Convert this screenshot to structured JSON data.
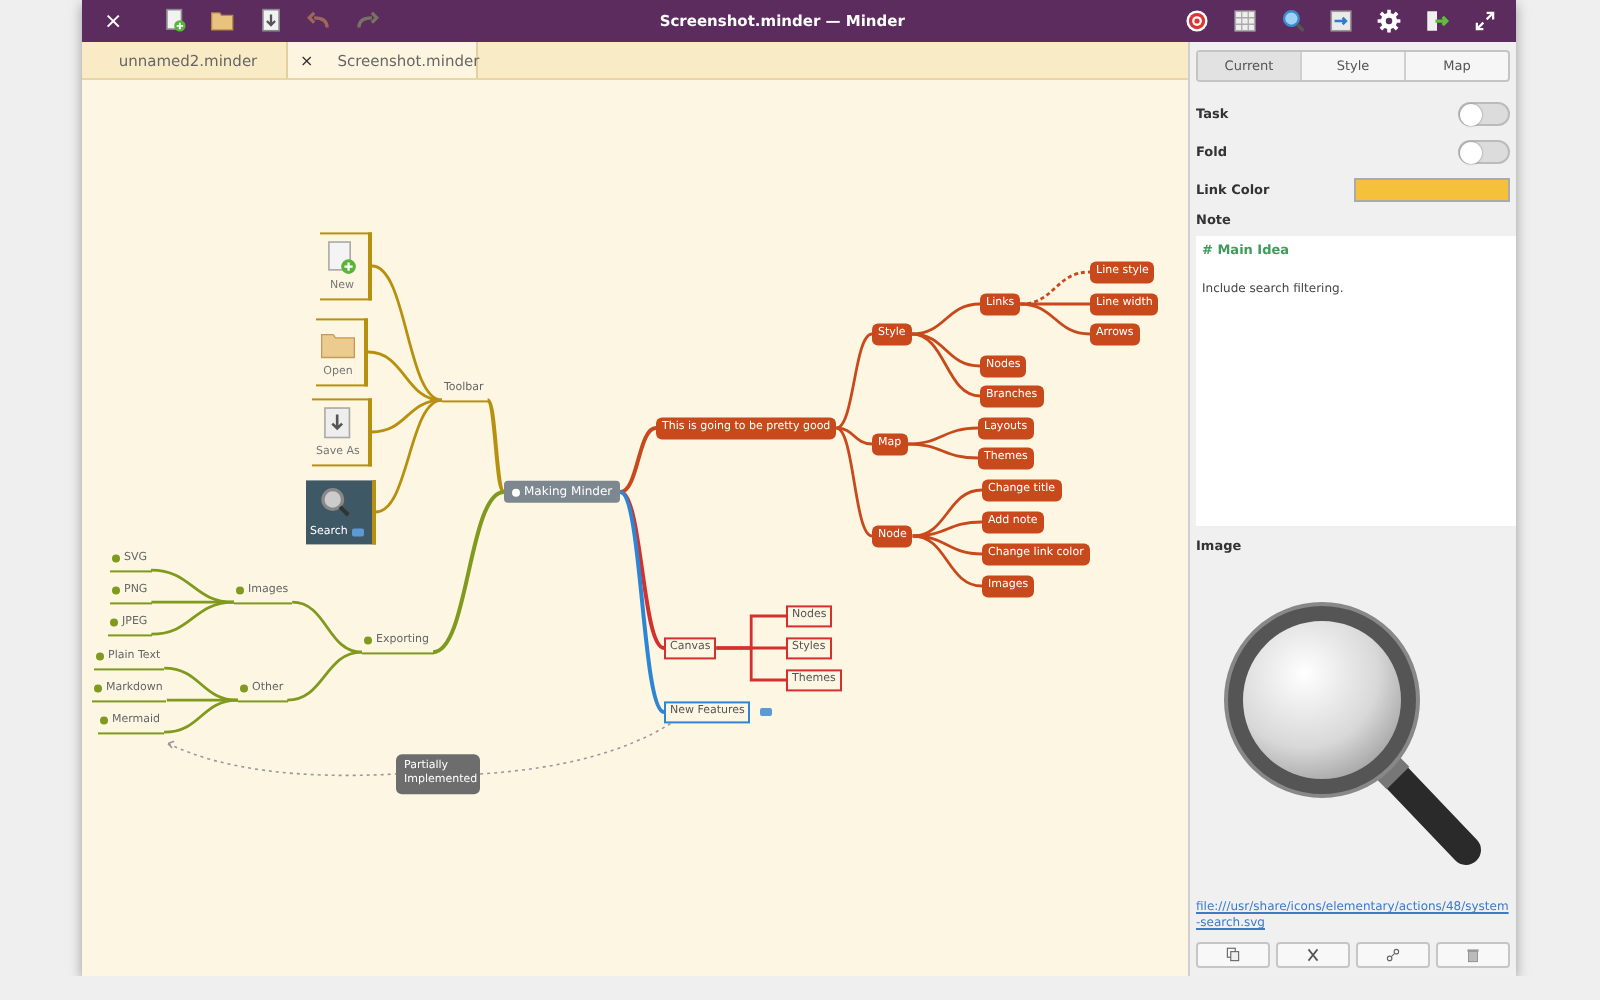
{
  "window": {
    "close": "×",
    "title": "Screenshot.minder — Minder",
    "left_tools": [
      {
        "kind": "new-file",
        "disabled": false
      },
      {
        "kind": "open",
        "disabled": false
      },
      {
        "kind": "save",
        "disabled": false
      },
      {
        "kind": "undo",
        "disabled": true
      },
      {
        "kind": "redo",
        "disabled": true
      }
    ],
    "right_tools": [
      {
        "kind": "target"
      },
      {
        "kind": "grid"
      },
      {
        "kind": "search"
      },
      {
        "kind": "export"
      },
      {
        "kind": "settings"
      },
      {
        "kind": "exit"
      },
      {
        "kind": "fullscreen"
      }
    ]
  },
  "tabs": [
    {
      "label": "unnamed2.minder",
      "selected": false
    },
    {
      "label": "Screenshot.minder",
      "selected": true,
      "close": "×"
    }
  ],
  "mind_map": {
    "root": {
      "text": "Making Minder",
      "kind": "root",
      "children": [
        {
          "text": "Toolbar",
          "kind": "text",
          "color": "#b8900f",
          "children": [
            {
              "text": "New",
              "kind": "image",
              "selected": false
            },
            {
              "text": "Open",
              "kind": "image",
              "selected": false
            },
            {
              "text": "Save As",
              "kind": "image",
              "selected": false
            },
            {
              "text": "Search",
              "kind": "image",
              "selected": true,
              "has_note": true
            }
          ]
        },
        {
          "text": "Exporting",
          "kind": "dot-text",
          "color": "#7f9a1c",
          "children": [
            {
              "text": "Images",
              "kind": "dot-text",
              "children": [
                {
                  "text": "SVG",
                  "kind": "dot-text"
                },
                {
                  "text": "PNG",
                  "kind": "dot-text"
                },
                {
                  "text": "JPEG",
                  "kind": "dot-text"
                }
              ]
            },
            {
              "text": "Other",
              "kind": "dot-text",
              "children": [
                {
                  "text": "Plain Text",
                  "kind": "dot-text"
                },
                {
                  "text": "Markdown",
                  "kind": "dot-text"
                },
                {
                  "text": "Mermaid",
                  "kind": "dot-text",
                  "connection": {
                    "label": "Partially Implemented"
                  }
                }
              ]
            }
          ]
        },
        {
          "text": "This is going to be pretty good",
          "kind": "filled",
          "color": "#c8491c",
          "children": [
            {
              "text": "Style",
              "kind": "filled",
              "children": [
                {
                  "text": "Links",
                  "kind": "filled",
                  "children": [
                    {
                      "text": "Line style",
                      "kind": "filled",
                      "dashed": true
                    },
                    {
                      "text": "Line width",
                      "kind": "filled"
                    },
                    {
                      "text": "Arrows",
                      "kind": "filled"
                    }
                  ]
                },
                {
                  "text": "Nodes",
                  "kind": "filled"
                },
                {
                  "text": "Branches",
                  "kind": "filled"
                }
              ]
            },
            {
              "text": "Map",
              "kind": "filled",
              "children": [
                {
                  "text": "Layouts",
                  "kind": "filled"
                },
                {
                  "text": "Themes",
                  "kind": "filled"
                }
              ]
            },
            {
              "text": "Node",
              "kind": "filled",
              "children": [
                {
                  "text": "Change title",
                  "kind": "filled"
                },
                {
                  "text": "Add note",
                  "kind": "filled"
                },
                {
                  "text": "Change link color",
                  "kind": "filled"
                },
                {
                  "text": "Images",
                  "kind": "filled"
                }
              ]
            }
          ]
        },
        {
          "text": "Canvas",
          "kind": "outlined",
          "color": "#d3302e",
          "children": [
            {
              "text": "Nodes",
              "kind": "outlined"
            },
            {
              "text": "Styles",
              "kind": "outlined"
            },
            {
              "text": "Themes",
              "kind": "outlined"
            }
          ]
        },
        {
          "text": "New Features",
          "kind": "outlined",
          "color": "#2c86d4",
          "has_note": true
        }
      ]
    }
  },
  "sidebar": {
    "tabs": [
      {
        "label": "Current",
        "selected": true
      },
      {
        "label": "Style",
        "selected": false
      },
      {
        "label": "Map",
        "selected": false
      }
    ],
    "switches": [
      {
        "label": "Task",
        "on": false
      },
      {
        "label": "Fold",
        "on": false
      }
    ],
    "link_color": {
      "label": "Link Color",
      "color": "#f6c13a"
    },
    "note": {
      "label": "Note",
      "heading": "# Main Idea",
      "text": "Include search filtering."
    },
    "image": {
      "label": "Image",
      "path": "file:///usr/share/icons/elementary/actions/48/system-search.svg"
    },
    "buttons": [
      {
        "kind": "copy"
      },
      {
        "kind": "cut"
      },
      {
        "kind": "link"
      },
      {
        "kind": "delete"
      }
    ]
  }
}
